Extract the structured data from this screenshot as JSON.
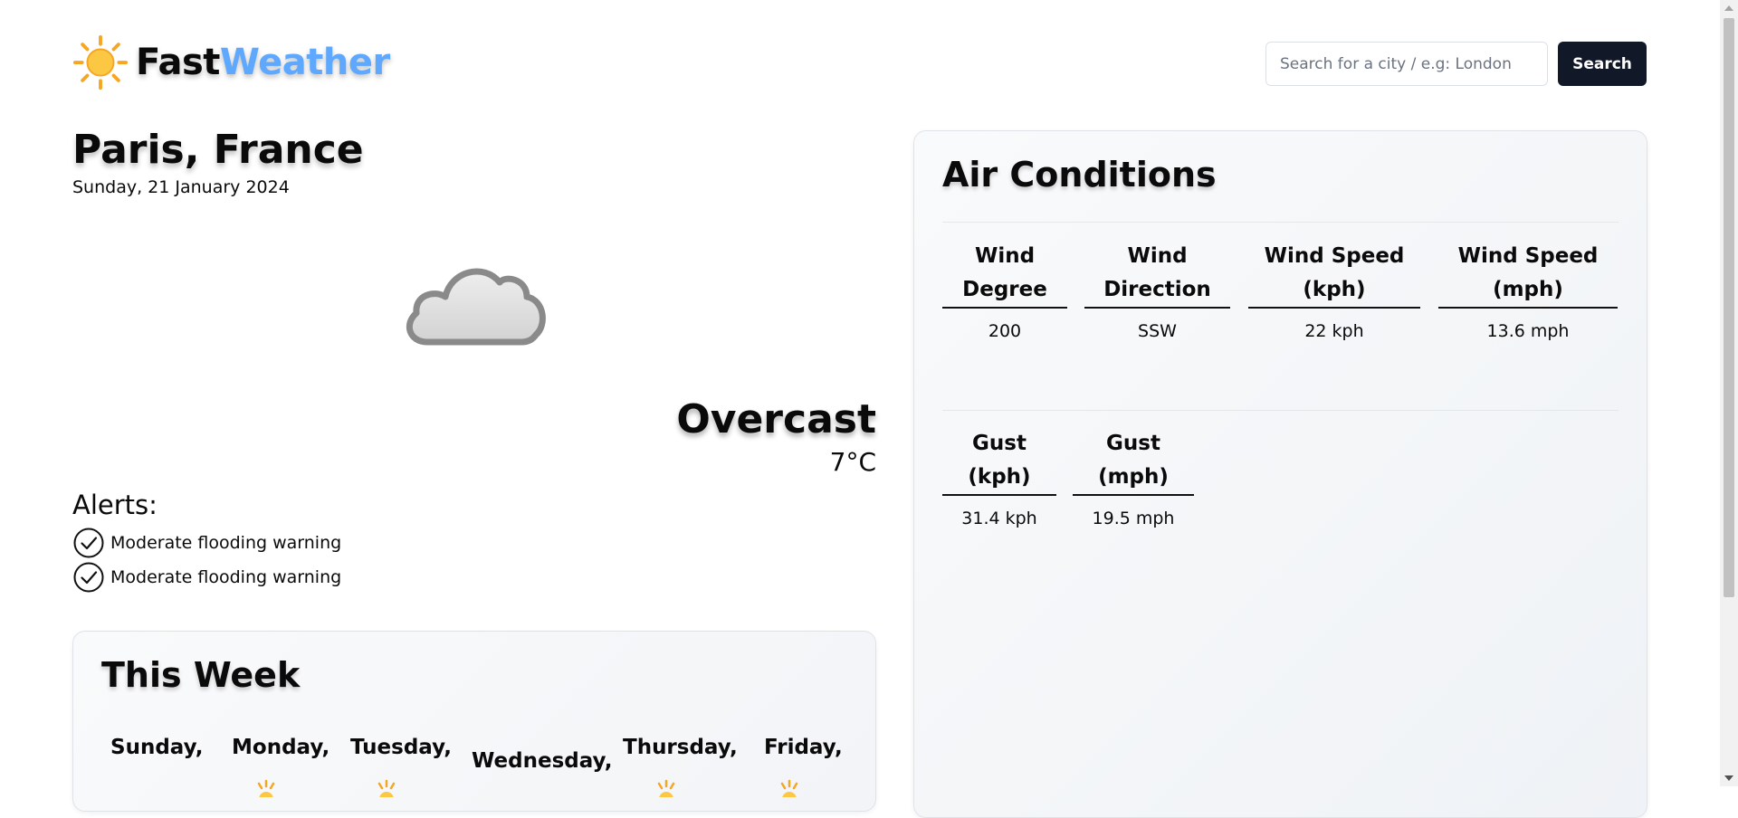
{
  "brand": {
    "part1": "Fast",
    "part2": "Weather"
  },
  "search": {
    "placeholder": "Search for a city / e.g: London",
    "button_label": "Search"
  },
  "location": {
    "city": "Paris, France",
    "date": "Sunday, 21 January 2024"
  },
  "current": {
    "condition": "Overcast",
    "temperature": "7°C",
    "icon": "cloud-icon"
  },
  "alerts": {
    "title": "Alerts:",
    "items": [
      "Moderate flooding warning",
      "Moderate flooding warning"
    ]
  },
  "week": {
    "title": "This Week",
    "days": [
      "Sunday,",
      "Monday,",
      "Tuesday,",
      "Wednesday,",
      "Thursday,",
      "Friday,"
    ]
  },
  "air": {
    "title": "Air Conditions",
    "row1": [
      {
        "label_line1": "Wind",
        "label_line2": "Degree",
        "value": "200"
      },
      {
        "label_line1": "Wind",
        "label_line2": "Direction",
        "value": "SSW"
      },
      {
        "label_line1": "Wind Speed",
        "label_line2": "(kph)",
        "value": "22 kph"
      },
      {
        "label_line1": "Wind Speed",
        "label_line2": "(mph)",
        "value": "13.6 mph"
      }
    ],
    "row2": [
      {
        "label": "Gust (kph)",
        "value": "31.4 kph"
      },
      {
        "label": "Gust (mph)",
        "value": "19.5 mph"
      }
    ]
  },
  "colors": {
    "accent": "#5ea9ff",
    "button_bg": "#111827",
    "sun": "#f7b733"
  }
}
